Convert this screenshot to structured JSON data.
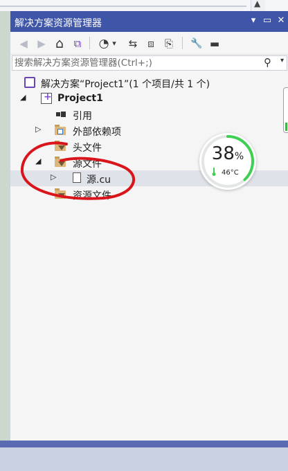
{
  "background": {
    "scroll_up_glyph": "▲"
  },
  "panel": {
    "title": "解决方案资源管理器",
    "dropdown_glyph": "▾",
    "pin_glyph": "▭",
    "close_glyph": "✕"
  },
  "toolbar": {
    "back_glyph": "◀",
    "forward_glyph": "▶",
    "home_glyph": "⌂",
    "switch_views_glyph": "⧉",
    "pending_changes_glyph": "◔",
    "pending_dropdown_glyph": "▾",
    "sync_glyph": "⇆",
    "collapse_all_glyph": "⧈",
    "show_all_files_glyph": "⎘",
    "properties_glyph": "🔧",
    "preview_glyph": "▬"
  },
  "search": {
    "placeholder": "搜索解决方案资源管理器(Ctrl+;)",
    "search_glyph": "⚲",
    "dropdown_glyph": "▾"
  },
  "tree": {
    "solution": "解决方案“Project1”(1 个项目/共 1 个)",
    "project": "Project1",
    "references": "引用",
    "external_dependencies": "外部依赖项",
    "header_files": "头文件",
    "source_files": "源文件",
    "source_file": "源.cu",
    "resource_files": "资源文件",
    "expanded_glyph": "◢",
    "collapsed_glyph": "▷"
  },
  "monitor": {
    "cpu_percent": 38,
    "cpu_percent_label": "38",
    "percent_sign": "%",
    "temperature": "46°C",
    "ring_color": "#3fcf52"
  },
  "annotation": {
    "color": "#d9151b"
  }
}
